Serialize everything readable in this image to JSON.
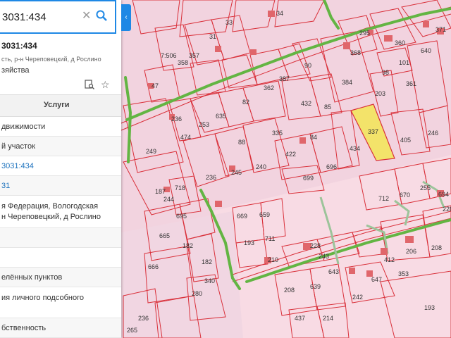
{
  "search": {
    "value": "3031:434"
  },
  "collapse_arrow": "‹",
  "card": {
    "title": "3031:434",
    "address_line": "сть, р-н Череповецкий, д Рослино",
    "category": "зяйства"
  },
  "tabs": {
    "services": "Услуги"
  },
  "details": [
    "движимости",
    "й участок",
    "3031:434",
    "31",
    "я Федерация, Вологодская",
    "н Череповецкий, д Рослино",
    "елённых пунктов",
    "ия личного подсобного",
    "бственность"
  ],
  "map": {
    "highlight_color": "#f3e36a",
    "road_color": "#63b543",
    "boundary_color": "#d9303a",
    "labels": [
      "31",
      "33",
      "34",
      "7:506",
      "357",
      "358",
      "47",
      "295",
      "360",
      "371",
      "368",
      "640",
      "98",
      "101",
      "361",
      "362",
      "387",
      "90",
      "384",
      "203",
      "432",
      "236",
      "635",
      "82",
      "85",
      "88",
      "474",
      "253",
      "335",
      "84",
      "337",
      "246",
      "249",
      "434",
      "405",
      "422",
      "696",
      "236",
      "245",
      "240",
      "699",
      "187",
      "718",
      "244",
      "712",
      "670",
      "255",
      "694",
      "695",
      "669",
      "659",
      "665",
      "182",
      "228",
      "666",
      "193",
      "711",
      "182",
      "228",
      "412",
      "353",
      "206",
      "208",
      "210",
      "280",
      "340",
      "643",
      "647",
      "236",
      "208",
      "639",
      "243",
      "242",
      "193",
      "437",
      "214",
      "265",
      "264",
      "439"
    ]
  }
}
